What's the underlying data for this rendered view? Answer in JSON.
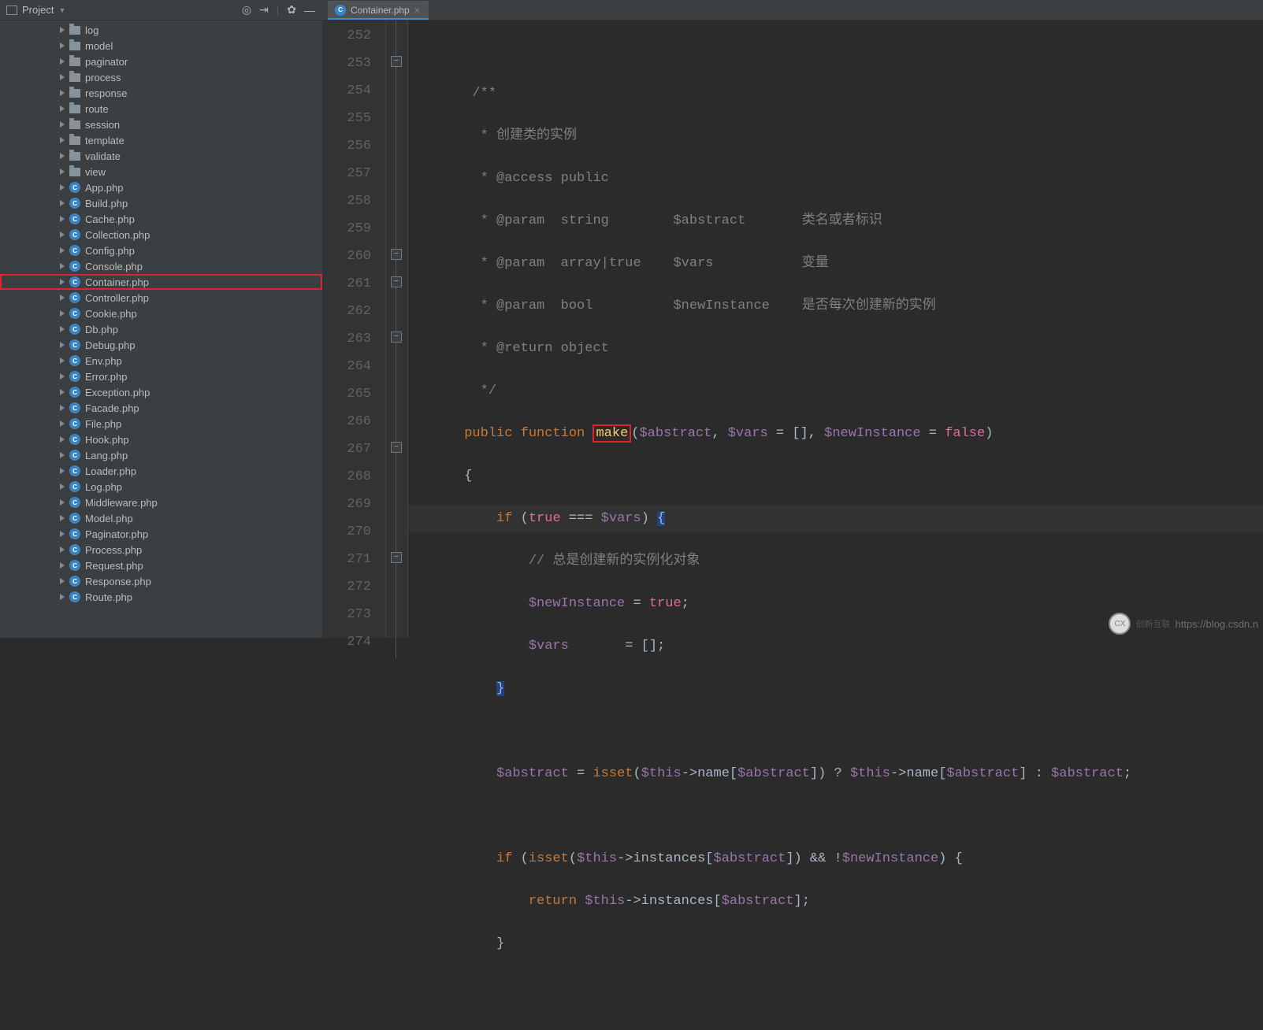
{
  "header": {
    "project_label": "Project"
  },
  "tab": {
    "filename": "Container.php"
  },
  "tree": {
    "folders": [
      "log",
      "model",
      "paginator",
      "process",
      "response",
      "route",
      "session",
      "template",
      "validate",
      "view"
    ],
    "files": [
      "App.php",
      "Build.php",
      "Cache.php",
      "Collection.php",
      "Config.php",
      "Console.php",
      "Container.php",
      "Controller.php",
      "Cookie.php",
      "Db.php",
      "Debug.php",
      "Env.php",
      "Error.php",
      "Exception.php",
      "Facade.php",
      "File.php",
      "Hook.php",
      "Lang.php",
      "Loader.php",
      "Log.php",
      "Middleware.php",
      "Model.php",
      "Paginator.php",
      "Process.php",
      "Request.php",
      "Response.php",
      "Route.php"
    ],
    "selected": "Container.php"
  },
  "gutter": {
    "start": 252,
    "end": 274
  },
  "code": {
    "l252": "",
    "l253": "/**",
    "l254": " * 创建类的实例",
    "l255": " * @access public",
    "l256": " * @param  string        $abstract       类名或者标识",
    "l257": " * @param  array|true    $vars           变量",
    "l258": " * @param  bool          $newInstance    是否每次创建新的实例",
    "l259": " * @return object",
    "l260": " */",
    "l261_kw1": "public",
    "l261_kw2": "function",
    "l261_fn": "make",
    "l261_rest": "($abstract, $vars = [], $newInstance = ",
    "l261_false": "false",
    "l261_end": ")",
    "l262": "{",
    "l263_if": "if",
    "l263_true": "true",
    "l263_op": " === ",
    "l263_vars": "$vars",
    "l263_close": ") ",
    "l263_brace": "{",
    "l264": "// 总是创建新的实例化对象",
    "l265_var": "$newInstance",
    "l265_eq": " = ",
    "l265_true": "true",
    "l265_semi": ";",
    "l266_var": "$vars",
    "l266_rest": "       = [];",
    "l267": "}",
    "l268": "",
    "l269_a": "$abstract = ",
    "l269_isset": "isset",
    "l269_b": "($this->name[$abstract]) ? $this->name[$abstract] : $abstract;",
    "l270": "",
    "l271_if": "if",
    "l271_a": " (",
    "l271_isset": "isset",
    "l271_b": "($this->instances[$abstract]) && !$newInstance) {",
    "l272_ret": "return",
    "l272_a": " $this->instances[$abstract];",
    "l273": "}"
  },
  "watermark": {
    "text": "https://blog.csdn.n",
    "badge": "创新互联"
  }
}
